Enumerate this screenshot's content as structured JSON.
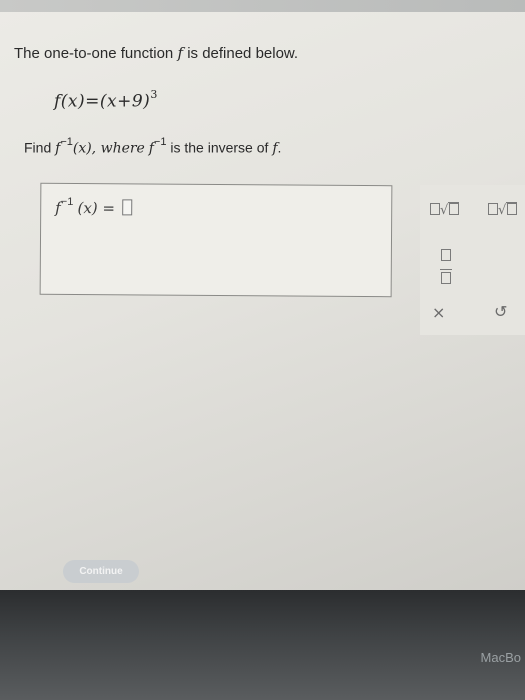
{
  "question": {
    "prompt_prefix": "The one-to-one function",
    "prompt_var": "f",
    "prompt_suffix": "is defined below.",
    "formula_lhs": "f(x)=(x+9)",
    "formula_exp": "3",
    "task_find": "Find",
    "task_fn": "f",
    "task_inv_exp": "−1",
    "task_arg": "(x), where",
    "task_fn2": "f",
    "task_inv_exp2": "−1",
    "task_suffix": "is the inverse of",
    "task_end_var": "f",
    "task_end": "."
  },
  "answer": {
    "lhs_fn": "f",
    "lhs_exp": "−1",
    "lhs_rest": "(x) ="
  },
  "palette": {
    "clear_symbol": "×",
    "undo_symbol": "↺"
  },
  "actions": {
    "continue_label": "Continue"
  },
  "device": {
    "brand": "MacBo"
  },
  "colors": {
    "continue_bg": "#c9cdd0"
  }
}
